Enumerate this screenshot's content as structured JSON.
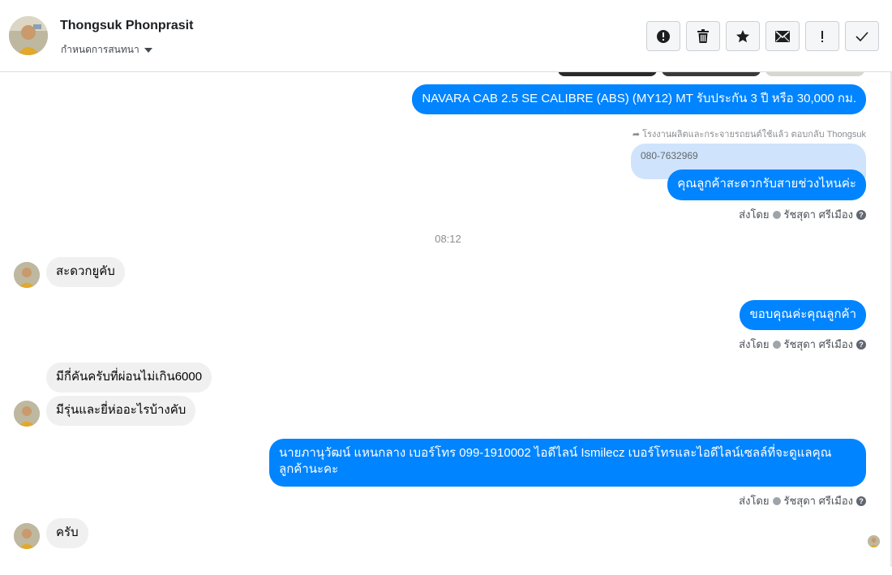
{
  "header": {
    "name": "Thongsuk Phonprasit",
    "subtitle": "กำหนดการสนทนา"
  },
  "toolbar": {
    "buttons": [
      {
        "icon": "alert-circle-icon",
        "label": "report"
      },
      {
        "icon": "trash-icon",
        "label": "delete"
      },
      {
        "icon": "star-icon",
        "label": "star"
      },
      {
        "icon": "envelope-icon",
        "label": "mark-unread"
      },
      {
        "icon": "exclamation-icon",
        "label": "spam"
      },
      {
        "icon": "checkmark-icon",
        "label": "done"
      }
    ]
  },
  "colors": {
    "outgoing_bubble": "#0084ff",
    "incoming_bubble": "#f0f0f0",
    "quoted_bubble": "#cfe4fc"
  },
  "messages": {
    "m1": "NAVARA CAB 2.5 SE CALIBRE (ABS) (MY12) MT รับประกัน 3 ปี หรือ 30,000 กม.",
    "reply_note": "โรงงานผลิตและกระจายรถยนต์ใช้แล้ว ตอบกลับ Thongsuk",
    "quoted": "080-7632969",
    "m2": "คุณลูกค้าสะดวกรับสายช่วงไหนค่ะ",
    "sent_by_1": "ส่งโดย",
    "sender_1": "รัชสุดา ศรีเมือง",
    "time": "08:12",
    "in1": "สะดวกยูคับ",
    "m3": "ขอบคุณค่ะคุณลูกค้า",
    "sent_by_2": "ส่งโดย",
    "sender_2": "รัชสุดา ศรีเมือง",
    "in2": "มีกี่คันครับที่ผ่อนไม่เกิน6000",
    "in3": "มีรุ่นและยี่ห่ออะไรบ้างคับ",
    "m4_line1": "นายภานุวัฒน์ แหนกลาง เบอร์โทร 099-1910002 ไอดีไลน์ Ismilecz  เบอร์โทรและไอดีไลน์เซลล์ที่จะดูแลคุณ",
    "m4_line2": "ลูกค้านะคะ",
    "sent_by_3": "ส่งโดย",
    "sender_3": "รัชสุดา ศรีเมือง",
    "in4": "ครับ"
  }
}
